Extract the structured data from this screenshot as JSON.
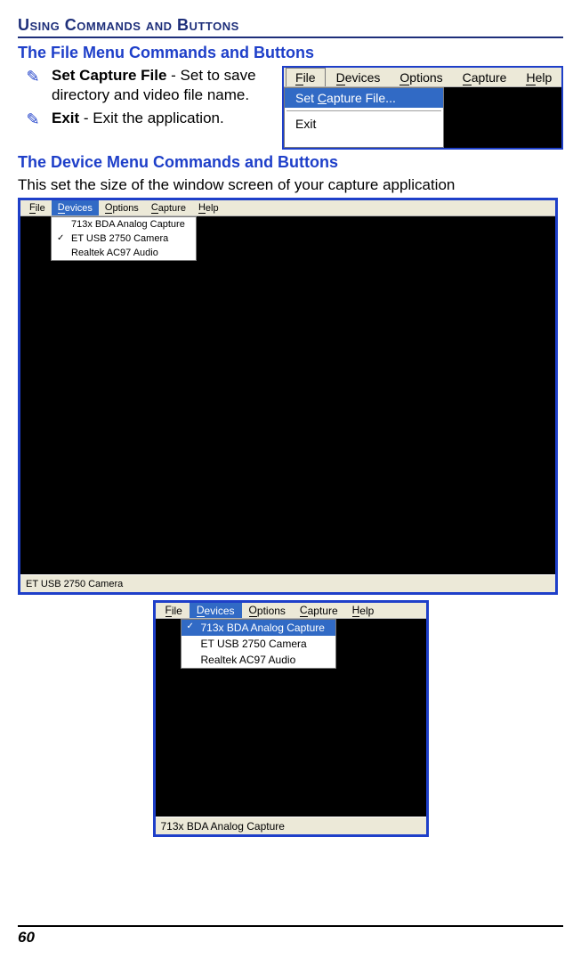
{
  "section_title": "Using Commands and Buttons",
  "file_menu": {
    "heading": "The File Menu Commands and Buttons",
    "items": [
      {
        "bold": "Set Capture File",
        "rest": " - Set to save directory and video file name."
      },
      {
        "bold": "Exit",
        "rest": " - Exit the application."
      }
    ],
    "menubar": [
      "File",
      "Devices",
      "Options",
      "Capture",
      "Help"
    ],
    "dropdown": [
      {
        "label": "Set Capture File...",
        "selected": true
      },
      {
        "label": "Exit",
        "selected": false
      }
    ]
  },
  "device_menu": {
    "heading": "The Device Menu Commands and Buttons",
    "intro": "This set the size of the window screen of your capture application",
    "app1": {
      "menubar": [
        "File",
        "Devices",
        "Options",
        "Capture",
        "Help"
      ],
      "active_index": 1,
      "dropdown": [
        {
          "label": "713x BDA Analog Capture",
          "checked": false,
          "selected": false
        },
        {
          "label": "ET USB 2750 Camera",
          "checked": true,
          "selected": false
        },
        {
          "label": "Realtek AC97 Audio",
          "checked": false,
          "selected": false
        }
      ],
      "status": "ET USB 2750 Camera"
    },
    "app2": {
      "menubar": [
        "File",
        "Devices",
        "Options",
        "Capture",
        "Help"
      ],
      "active_index": 1,
      "dropdown": [
        {
          "label": "713x BDA Analog Capture",
          "checked": true,
          "selected": true
        },
        {
          "label": "ET USB 2750 Camera",
          "checked": false,
          "selected": false
        },
        {
          "label": "Realtek AC97 Audio",
          "checked": false,
          "selected": false
        }
      ],
      "status": "713x BDA Analog Capture"
    }
  },
  "page_number": "60"
}
